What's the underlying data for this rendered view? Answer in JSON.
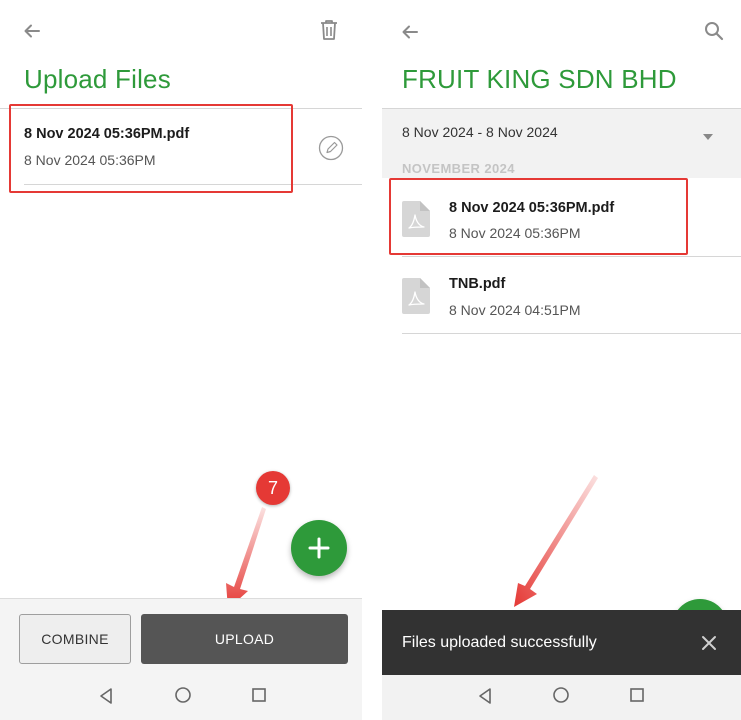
{
  "left_screen": {
    "title": "Upload Files",
    "file": {
      "name": "8 Nov 2024 05:36PM.pdf",
      "date": "8 Nov 2024 05:36PM"
    },
    "step_badge": "7",
    "combine_label": "COMBINE",
    "upload_label": "UPLOAD",
    "icons": [
      "back-arrow",
      "trash",
      "edit-pencil",
      "plus"
    ]
  },
  "right_screen": {
    "title": "FRUIT KING SDN BHD",
    "date_range": "8 Nov 2024 - 8 Nov 2024",
    "section_header": "NOVEMBER 2024",
    "files": [
      {
        "name": "8 Nov 2024 05:36PM.pdf",
        "date": "8 Nov 2024 05:36PM"
      },
      {
        "name": "TNB.pdf",
        "date": "8 Nov 2024 04:51PM"
      }
    ],
    "snackbar_message": "Files uploaded successfully",
    "icons": [
      "back-arrow",
      "search",
      "chevron-down",
      "pdf-file",
      "close"
    ]
  },
  "colors": {
    "accent_green": "#2e9a3a",
    "highlight_red": "#e53935",
    "upload_button": "#555555",
    "snackbar": "#323232",
    "navbar": "#f2f2f2"
  }
}
